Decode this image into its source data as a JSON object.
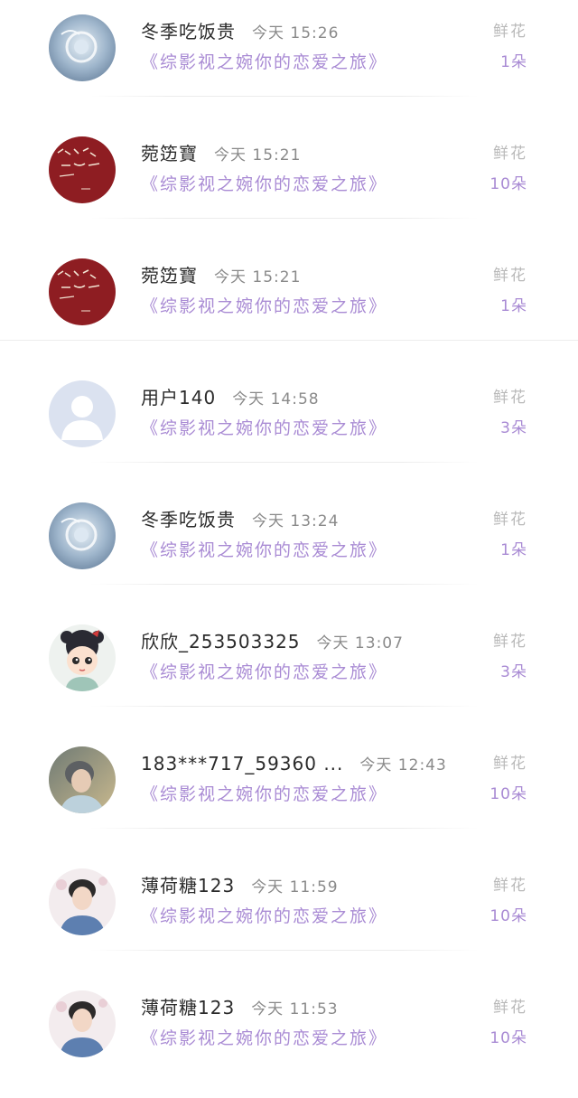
{
  "list": {
    "items": [
      {
        "username": "冬季吃饭贵",
        "time": "今天 15:26",
        "book": "《综影视之婉你的恋爱之旅》",
        "gift_label": "鲜花",
        "gift_count": "1朵",
        "avatar": "ice-flower-avatar"
      },
      {
        "username": "菀笾寶",
        "time": "今天 15:21",
        "book": "《综影视之婉你的恋爱之旅》",
        "gift_label": "鲜花",
        "gift_count": "10朵",
        "avatar": "red-calligraphy-avatar"
      },
      {
        "username": "菀笾寶",
        "time": "今天 15:21",
        "book": "《综影视之婉你的恋爱之旅》",
        "gift_label": "鲜花",
        "gift_count": "1朵",
        "avatar": "red-calligraphy-avatar"
      },
      {
        "username": "用户140",
        "time": "今天 14:58",
        "book": "《综影视之婉你的恋爱之旅》",
        "gift_label": "鲜花",
        "gift_count": "3朵",
        "avatar": "default-user-avatar"
      },
      {
        "username": "冬季吃饭贵",
        "time": "今天 13:24",
        "book": "《综影视之婉你的恋爱之旅》",
        "gift_label": "鲜花",
        "gift_count": "1朵",
        "avatar": "ice-flower-avatar"
      },
      {
        "username": "欣欣_253503325",
        "time": "今天 13:07",
        "book": "《综影视之婉你的恋爱之旅》",
        "gift_label": "鲜花",
        "gift_count": "3朵",
        "avatar": "cartoon-girl-avatar"
      },
      {
        "username": "183***717_59360 ...",
        "time": "今天 12:43",
        "book": "《综影视之婉你的恋爱之旅》",
        "gift_label": "鲜花",
        "gift_count": "10朵",
        "avatar": "photo-boy-avatar"
      },
      {
        "username": "薄荷糖123",
        "time": "今天 11:59",
        "book": "《综影视之婉你的恋爱之旅》",
        "gift_label": "鲜花",
        "gift_count": "10朵",
        "avatar": "boy-blue-sweater-avatar"
      },
      {
        "username": "薄荷糖123",
        "time": "今天 11:53",
        "book": "《综影视之婉你的恋爱之旅》",
        "gift_label": "鲜花",
        "gift_count": "10朵",
        "avatar": "boy-blue-sweater-avatar"
      }
    ]
  }
}
